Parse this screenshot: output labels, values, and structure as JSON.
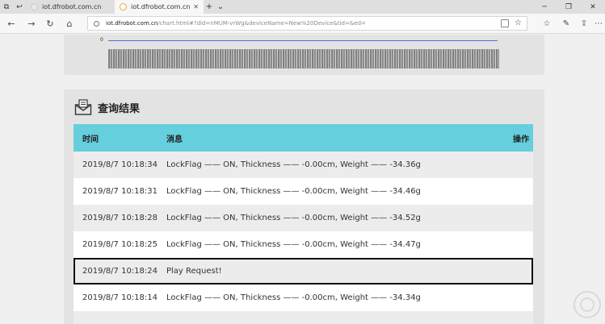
{
  "browser": {
    "tabs": [
      {
        "label": "iot.dfrobot.com.cn",
        "active": false
      },
      {
        "label": "iot.dfrobot.com.cn",
        "active": true
      }
    ],
    "address": {
      "host": "iot.dfrobot.com.cn",
      "path": "/chart.html#?did=nMUM-vrWg&deviceName=New%20Device&tid=&ed="
    }
  },
  "chart": {
    "axis_zero": "0"
  },
  "results": {
    "title": "查询结果",
    "columns": {
      "time": "时间",
      "message": "消息",
      "action": "操作"
    },
    "rows": [
      {
        "time": "2019/8/7 10:18:34",
        "message": "LockFlag —— ON, Thickness —— -0.00cm, Weight —— -34.36g"
      },
      {
        "time": "2019/8/7 10:18:31",
        "message": "LockFlag —— ON, Thickness —— -0.00cm, Weight —— -34.46g"
      },
      {
        "time": "2019/8/7 10:18:28",
        "message": "LockFlag —— ON, Thickness —— -0.00cm, Weight —— -34.52g"
      },
      {
        "time": "2019/8/7 10:18:25",
        "message": "LockFlag —— ON, Thickness —— -0.00cm, Weight —— -34.47g"
      },
      {
        "time": "2019/8/7 10:18:24",
        "message": "Play Request!"
      },
      {
        "time": "2019/8/7 10:18:14",
        "message": "LockFlag —— ON, Thickness —— -0.00cm, Weight —— -34.34g"
      }
    ]
  },
  "colors": {
    "header_bg": "#65cfdd",
    "chart_line": "#4a73c8"
  }
}
